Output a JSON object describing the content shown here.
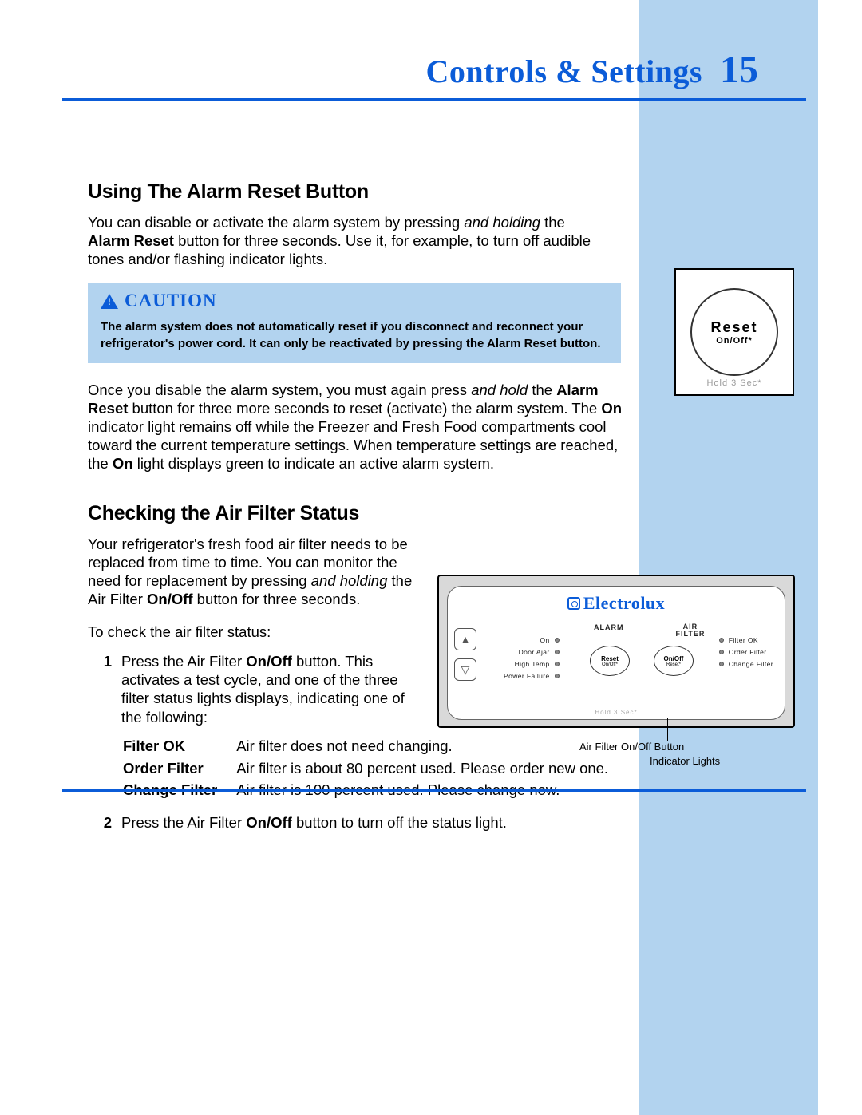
{
  "header": {
    "title": "Controls & Settings",
    "page": "15"
  },
  "s1": {
    "heading": "Using The Alarm Reset Button",
    "p1a": "You can disable or activate the alarm system by pressing ",
    "p1b": "and holding",
    "p1c": " the ",
    "p1d": "Alarm Reset",
    "p1e": " button for three seconds. Use it, for example, to turn off audible tones and/or flashing indicator lights.",
    "caution_label": "CAUTION",
    "caution_body": "The alarm system does not automatically reset if you disconnect and reconnect your refrigerator's power cord. It can only be reactivated by pressing the Alarm Reset button.",
    "p2a": "Once you disable the alarm system, you must again press ",
    "p2b": "and hold",
    "p2c": " the ",
    "p2d": "Alarm Reset",
    "p2e": " button for three more seconds to reset (activate) the alarm system. The ",
    "p2f": "On",
    "p2g": " indicator light remains off while the Freezer and Fresh Food compartments cool toward the current temperature settings. When temperature settings are reached, the ",
    "p2h": "On",
    "p2i": " light displays green to indicate an active alarm system."
  },
  "s2": {
    "heading": "Checking the Air Filter Status",
    "p1a": "Your refrigerator's fresh food air filter needs to be replaced from time to time. You can monitor the need for replacement by pressing ",
    "p1b": "and holding",
    "p1c": " the Air Filter ",
    "p1d": "On/Off",
    "p1e": " button for three seconds.",
    "p2": "To check the air filter status:",
    "li1a": "Press the Air Filter ",
    "li1b": "On/Off",
    "li1c": " button. This activates a test cycle, and one of the three filter status lights displays, indicating one of the following:",
    "li2a": "Press the Air Filter ",
    "li2b": "On/Off",
    "li2c": " button to turn off the status light.",
    "status": [
      {
        "k": "Filter OK",
        "v": "Air filter does not need changing."
      },
      {
        "k": "Order Filter",
        "v": "Air filter is about 80 percent used. Please order new one."
      },
      {
        "k": "Change Filter",
        "v": "Air filter is 100 percent used. Please change now."
      }
    ],
    "num1": "1",
    "num2": "2"
  },
  "reset_fig": {
    "l1": "Reset",
    "l2": "On/Off*",
    "hold": "Hold 3 Sec*"
  },
  "panel": {
    "brand": "Electrolux",
    "col_alarm": "ALARM",
    "col_air": "AIR",
    "col_filter": "FILTER",
    "alarm_items": [
      "On",
      "Door Ajar",
      "High Temp",
      "Power Failure"
    ],
    "filter_items": [
      "Filter OK",
      "Order Filter",
      "Change Filter"
    ],
    "reset": "Reset",
    "reset_sub": "On/Off*",
    "onoff": "On/Off",
    "onoff_sub": "Reset*",
    "hold": "Hold 3 Sec*",
    "callout1": "Air Filter On/Off Button",
    "callout2": "Indicator Lights",
    "up": "▲",
    "down": "▽"
  }
}
